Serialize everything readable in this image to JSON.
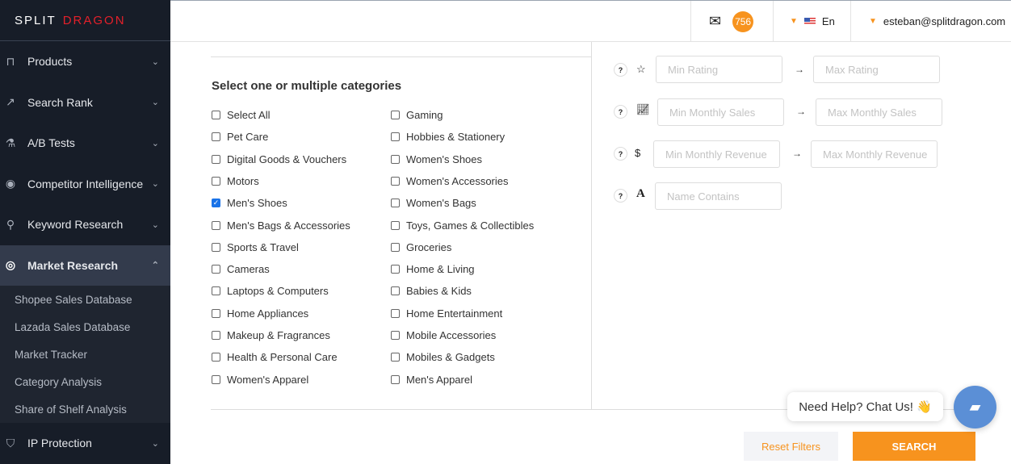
{
  "brand": {
    "left": "SPLIT",
    "right": "DRAGON"
  },
  "sidebar": {
    "items": [
      {
        "label": "Products",
        "icon": "bag-icon"
      },
      {
        "label": "Search Rank",
        "icon": "chart-line-icon"
      },
      {
        "label": "A/B Tests",
        "icon": "flask-icon"
      },
      {
        "label": "Competitor Intelligence",
        "icon": "eye-icon"
      },
      {
        "label": "Keyword Research",
        "icon": "search-icon"
      },
      {
        "label": "Market Research",
        "icon": "globe-icon",
        "active": true
      }
    ],
    "submenu": [
      "Shopee Sales Database",
      "Lazada Sales Database",
      "Market Tracker",
      "Category Analysis",
      "Share of Shelf Analysis"
    ],
    "ip": {
      "label": "IP Protection",
      "icon": "shield-icon"
    }
  },
  "header": {
    "messages": "756",
    "language": "En",
    "user": "esteban@splitdragon.com"
  },
  "categories": {
    "title": "Select one or multiple categories",
    "col1": [
      "Select All",
      "Pet Care",
      "Digital Goods & Vouchers",
      "Motors",
      "Men's Shoes",
      "Men's Bags & Accessories",
      "Sports & Travel",
      "Cameras",
      "Laptops & Computers",
      "Home Appliances",
      "Makeup & Fragrances",
      "Health & Personal Care",
      "Women's Apparel"
    ],
    "col2": [
      "Gaming",
      "Hobbies & Stationery",
      "Women's Shoes",
      "Women's Accessories",
      "Women's Bags",
      "Toys, Games & Collectibles",
      "Groceries",
      "Home & Living",
      "Babies & Kids",
      "Home Entertainment",
      "Mobile Accessories",
      "Mobiles & Gadgets",
      "Men's Apparel"
    ],
    "checked": [
      "Men's Shoes"
    ]
  },
  "filters": {
    "min_rating": "Min Rating",
    "max_rating": "Max Rating",
    "min_sales": "Min Monthly Sales",
    "max_sales": "Max Monthly Sales",
    "min_revenue": "Min Monthly Revenue",
    "max_revenue": "Max Monthly Revenue",
    "name": "Name Contains"
  },
  "actions": {
    "reset": "Reset Filters",
    "search": "SEARCH"
  },
  "chat": {
    "label": "Need Help? Chat Us! 👋"
  },
  "colors": {
    "accent": "#f7931e",
    "sidebar": "#171d28",
    "chat": "#5b8fd6"
  }
}
